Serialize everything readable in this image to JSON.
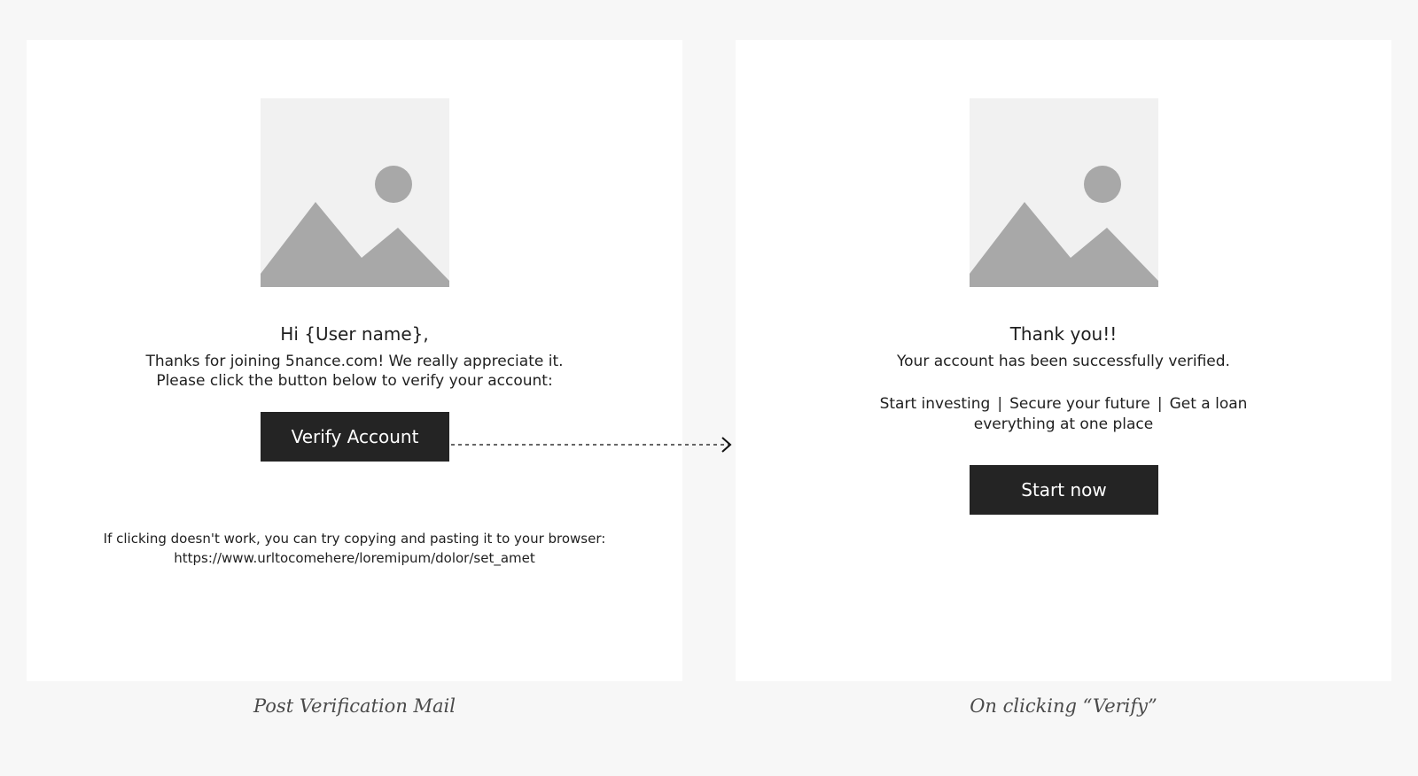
{
  "left": {
    "heading": "Hi {User name},",
    "body_line_1": "Thanks for joining 5nance.com! We really appreciate it.",
    "body_line_2": "Please click the button below to verify your account:",
    "button_label": "Verify Account",
    "fallback_line_1": "If clicking doesn't work, you can try copying and pasting it to your browser:",
    "fallback_url": "https://www.urltocomehere/loremipum/dolor/set_amet",
    "caption": "Post Verification Mail"
  },
  "right": {
    "heading": "Thank you!!",
    "body_line_1": "Your account has been successfully verified.",
    "links": [
      "Start investing",
      "Secure your future",
      "Get a loan"
    ],
    "separator": "|",
    "links_line_2": "everything at one place",
    "button_label": "Start now",
    "caption": "On clicking “Verify”"
  },
  "colors": {
    "page_background": "#f7f7f7",
    "panel_background": "#ffffff",
    "button_background": "#242424",
    "button_text": "#ffffff",
    "placeholder_background": "#f1f1f1",
    "placeholder_shapes": "#a8a8a8"
  },
  "icons": {
    "image_placeholder": "image-placeholder-icon",
    "arrow": "dashed-arrow-icon"
  }
}
